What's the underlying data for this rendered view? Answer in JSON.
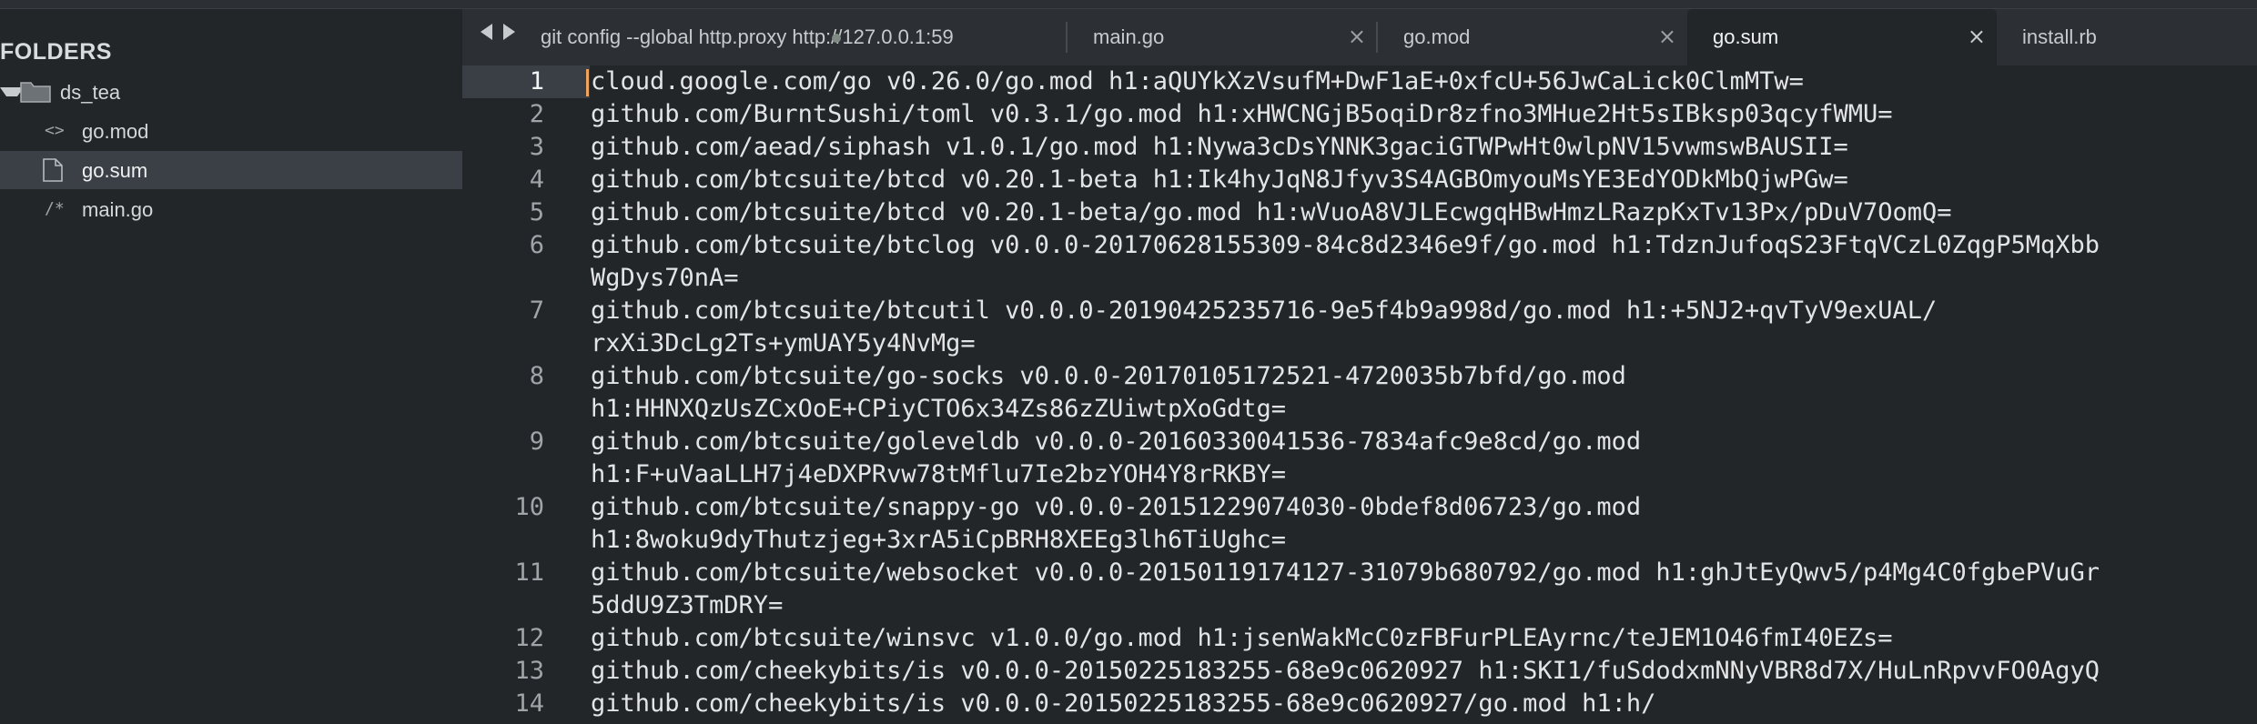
{
  "sidebar": {
    "header": "FOLDERS",
    "folder": {
      "name": "ds_tea",
      "icon": "folder-icon"
    },
    "files": [
      {
        "name": "go.mod",
        "icon": "code-file-icon",
        "icon_glyph": "<>"
      },
      {
        "name": "go.sum",
        "icon": "document-file-icon",
        "icon_glyph": ""
      },
      {
        "name": "main.go",
        "icon": "comment-file-icon",
        "icon_glyph": "/*"
      }
    ]
  },
  "tabs": [
    {
      "label": "git config --global http.proxy http://127.0.0.1:59",
      "state": "modified"
    },
    {
      "label": "main.go",
      "state": "closable"
    },
    {
      "label": "go.mod",
      "state": "closable"
    },
    {
      "label": "go.sum",
      "state": "active"
    },
    {
      "label": "install.rb",
      "state": "closable"
    }
  ],
  "editor": {
    "current_line": 1,
    "lines": [
      {
        "n": "1",
        "text": "cloud.google.com/go v0.26.0/go.mod h1:aQUYkXzVsufM+DwF1aE+0xfcU+56JwCaLick0ClmMTw="
      },
      {
        "n": "2",
        "text": "github.com/BurntSushi/toml v0.3.1/go.mod h1:xHWCNGjB5oqiDr8zfno3MHue2Ht5sIBksp03qcyfWMU="
      },
      {
        "n": "3",
        "text": "github.com/aead/siphash v1.0.1/go.mod h1:Nywa3cDsYNNK3gaciGTWPwHt0wlpNV15vwmswBAUSII="
      },
      {
        "n": "4",
        "text": "github.com/btcsuite/btcd v0.20.1-beta h1:Ik4hyJqN8Jfyv3S4AGBOmyouMsYE3EdYODkMbQjwPGw="
      },
      {
        "n": "5",
        "text": "github.com/btcsuite/btcd v0.20.1-beta/go.mod h1:wVuoA8VJLEcwgqHBwHmzLRazpKxTv13Px/pDuV7OomQ="
      },
      {
        "n": "6",
        "text": "github.com/btcsuite/btclog v0.0.0-20170628155309-84c8d2346e9f/go.mod h1:TdznJufoqS23FtqVCzL0ZqgP5MqXbb"
      },
      {
        "n": "",
        "text": "WgDys70nA="
      },
      {
        "n": "7",
        "text": "github.com/btcsuite/btcutil v0.0.0-20190425235716-9e5f4b9a998d/go.mod h1:+5NJ2+qvTyV9exUAL/"
      },
      {
        "n": "",
        "text": "rxXi3DcLg2Ts+ymUAY5y4NvMg="
      },
      {
        "n": "8",
        "text": "github.com/btcsuite/go-socks v0.0.0-20170105172521-4720035b7bfd/go.mod"
      },
      {
        "n": "",
        "text": "h1:HHNXQzUsZCxOoE+CPiyCTO6x34Zs86zZUiwtpXoGdtg="
      },
      {
        "n": "9",
        "text": "github.com/btcsuite/goleveldb v0.0.0-20160330041536-7834afc9e8cd/go.mod"
      },
      {
        "n": "",
        "text": "h1:F+uVaaLLH7j4eDXPRvw78tMflu7Ie2bzYOH4Y8rRKBY="
      },
      {
        "n": "10",
        "text": "github.com/btcsuite/snappy-go v0.0.0-20151229074030-0bdef8d06723/go.mod"
      },
      {
        "n": "",
        "text": "h1:8woku9dyThutzjeg+3xrA5iCpBRH8XEEg3lh6TiUghc="
      },
      {
        "n": "11",
        "text": "github.com/btcsuite/websocket v0.0.0-20150119174127-31079b680792/go.mod h1:ghJtEyQwv5/p4Mg4C0fgbePVuGr"
      },
      {
        "n": "",
        "text": "5ddU9Z3TmDRY="
      },
      {
        "n": "12",
        "text": "github.com/btcsuite/winsvc v1.0.0/go.mod h1:jsenWakMcC0zFBFurPLEAyrnc/teJEM1O46fmI40EZs="
      },
      {
        "n": "13",
        "text": "github.com/cheekybits/is v0.0.0-20150225183255-68e9c0620927 h1:SKI1/fuSdodxmNNyVBR8d7X/HuLnRpvvFO0AgyQ"
      },
      {
        "n": "14",
        "text": "github.com/cheekybits/is v0.0.0-20150225183255-68e9c0620927/go.mod h1:h/"
      }
    ]
  },
  "colors": {
    "background": "#232629",
    "tabbar": "#2c2f33",
    "selection": "#3b4046",
    "caret": "#f0a35e",
    "text": "#e2e4e6"
  }
}
